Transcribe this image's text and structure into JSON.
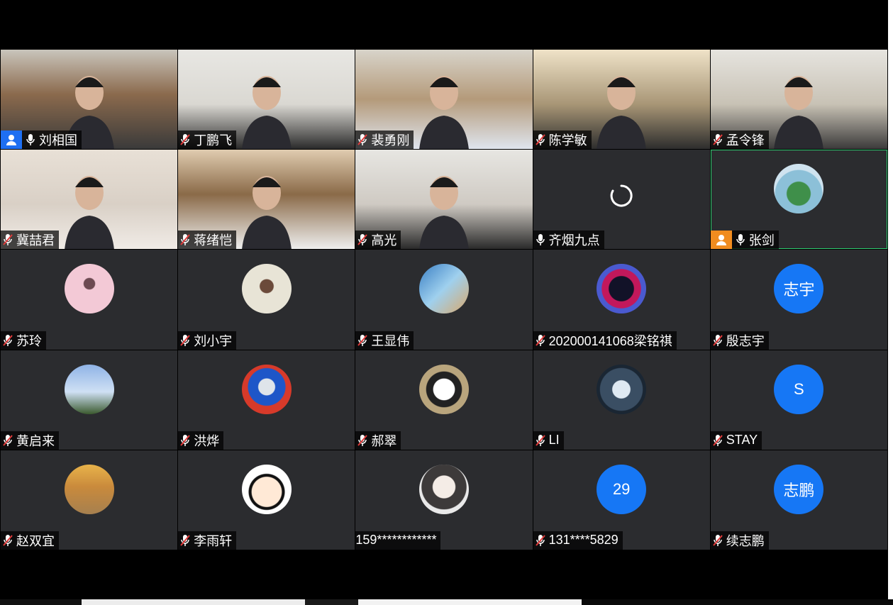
{
  "colors": {
    "host_badge": "#1e6ff2",
    "cohost_badge": "#f08c1f",
    "text_avatar": "#1677f5",
    "active_border": "#2ecc71"
  },
  "participants": [
    {
      "name": "刘相国",
      "mic": "on",
      "badge": "host",
      "kind": "video"
    },
    {
      "name": "丁鹏飞",
      "mic": "muted",
      "kind": "video"
    },
    {
      "name": "裴勇刚",
      "mic": "muted",
      "kind": "video"
    },
    {
      "name": "陈学敏",
      "mic": "muted",
      "kind": "video"
    },
    {
      "name": "孟令锋",
      "mic": "muted",
      "kind": "video"
    },
    {
      "name": "冀喆君",
      "mic": "muted",
      "kind": "video"
    },
    {
      "name": "蒋绪恺",
      "mic": "muted",
      "kind": "video"
    },
    {
      "name": "高光",
      "mic": "muted",
      "kind": "video"
    },
    {
      "name": "齐烟九点",
      "mic": "on",
      "kind": "loading"
    },
    {
      "name": "张剑",
      "mic": "on",
      "badge": "cohost",
      "kind": "avatar-image",
      "avatar": "lake-island-avatar",
      "active": true
    },
    {
      "name": "苏玲",
      "mic": "muted",
      "kind": "avatar-image",
      "avatar": "pink-tree-avatar"
    },
    {
      "name": "刘小宇",
      "mic": "muted",
      "kind": "avatar-image",
      "avatar": "girl-sketch-avatar"
    },
    {
      "name": "王显伟",
      "mic": "muted",
      "kind": "avatar-image",
      "avatar": "shrimp-avatar"
    },
    {
      "name": "202000141068梁铭祺",
      "mic": "muted",
      "kind": "avatar-image",
      "avatar": "spider-hero-avatar"
    },
    {
      "name": "殷志宇",
      "mic": "muted",
      "kind": "avatar-text",
      "avatar_text": "志宇"
    },
    {
      "name": "黄启来",
      "mic": "muted",
      "kind": "avatar-image",
      "avatar": "sunset-tree-avatar"
    },
    {
      "name": "洪烨",
      "mic": "muted",
      "kind": "avatar-image",
      "avatar": "train-toy-avatar"
    },
    {
      "name": "郝翠",
      "mic": "muted",
      "kind": "avatar-image",
      "avatar": "cat-avatar"
    },
    {
      "name": "LI",
      "mic": "muted",
      "kind": "avatar-image",
      "avatar": "dragon-avatar"
    },
    {
      "name": "STAY",
      "mic": "muted",
      "kind": "avatar-text",
      "avatar_text": "S"
    },
    {
      "name": "赵双宜",
      "mic": "muted",
      "kind": "avatar-image",
      "avatar": "balloon-avatar"
    },
    {
      "name": "李雨轩",
      "mic": "muted",
      "kind": "avatar-image",
      "avatar": "cartoon-boy-avatar"
    },
    {
      "name": "159************",
      "mic": "none",
      "kind": "avatar-image",
      "avatar": "anime-boy-avatar"
    },
    {
      "name": "131****5829",
      "mic": "muted",
      "kind": "avatar-text",
      "avatar_text": "29"
    },
    {
      "name": "续志鹏",
      "mic": "muted",
      "kind": "avatar-text",
      "avatar_text": "志鹏"
    }
  ]
}
